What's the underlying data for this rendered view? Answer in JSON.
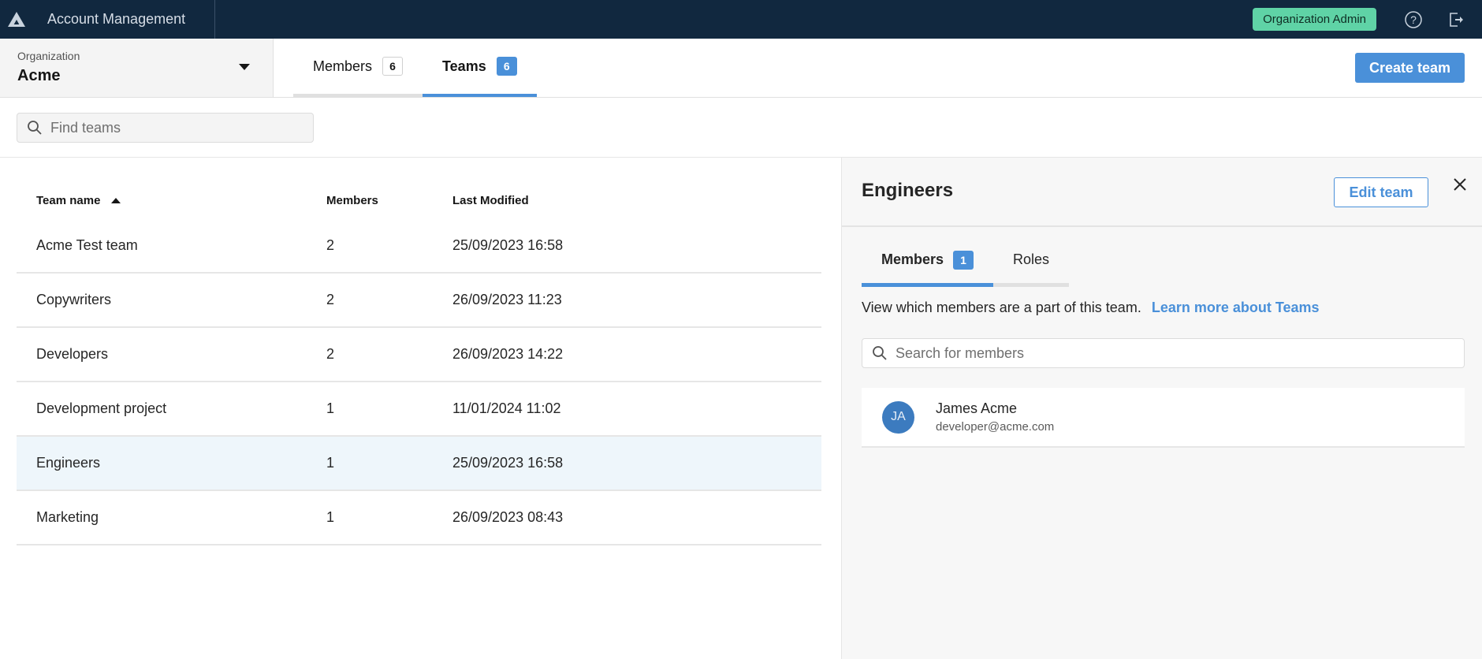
{
  "header": {
    "app_title": "Account Management",
    "logo_icon": "triangle-logo-icon",
    "role_badge": "Organization Admin",
    "help_icon": "help-circle-icon",
    "logout_icon": "logout-icon"
  },
  "organization": {
    "label": "Organization",
    "value": "Acme"
  },
  "tabs": [
    {
      "label": "Members",
      "count": "6",
      "active": false
    },
    {
      "label": "Teams",
      "count": "6",
      "active": true
    }
  ],
  "actions": {
    "create_team": "Create team"
  },
  "search": {
    "placeholder": "Find teams",
    "value": ""
  },
  "table": {
    "columns": {
      "name": "Team name",
      "members": "Members",
      "modified": "Last Modified"
    },
    "sort": {
      "column": "name",
      "direction": "ascending"
    },
    "rows": [
      {
        "name": "Acme Test team",
        "members": "2",
        "modified": "25/09/2023 16:58"
      },
      {
        "name": "Copywriters",
        "members": "2",
        "modified": "26/09/2023 11:23"
      },
      {
        "name": "Developers",
        "members": "2",
        "modified": "26/09/2023 14:22"
      },
      {
        "name": "Development project",
        "members": "1",
        "modified": "11/01/2024 11:02"
      },
      {
        "name": "Engineers",
        "members": "1",
        "modified": "25/09/2023 16:58",
        "selected": true
      },
      {
        "name": "Marketing",
        "members": "1",
        "modified": "26/09/2023 08:43"
      }
    ]
  },
  "panel": {
    "title": "Engineers",
    "edit_button": "Edit team",
    "tabs": [
      {
        "label": "Members",
        "count": "1",
        "active": true
      },
      {
        "label": "Roles",
        "active": false
      }
    ],
    "description": "View which members are a part of this team.",
    "learn_more": "Learn more about Teams",
    "search_placeholder": "Search for members",
    "members": [
      {
        "initials": "JA",
        "name": "James Acme",
        "email": "developer@acme.com"
      }
    ]
  },
  "colors": {
    "topbar": "#11283f",
    "accent": "#4a90d9",
    "role_badge": "#5fd3a6",
    "selected_row": "#eef6fb",
    "avatar": "#3c7bbf"
  }
}
